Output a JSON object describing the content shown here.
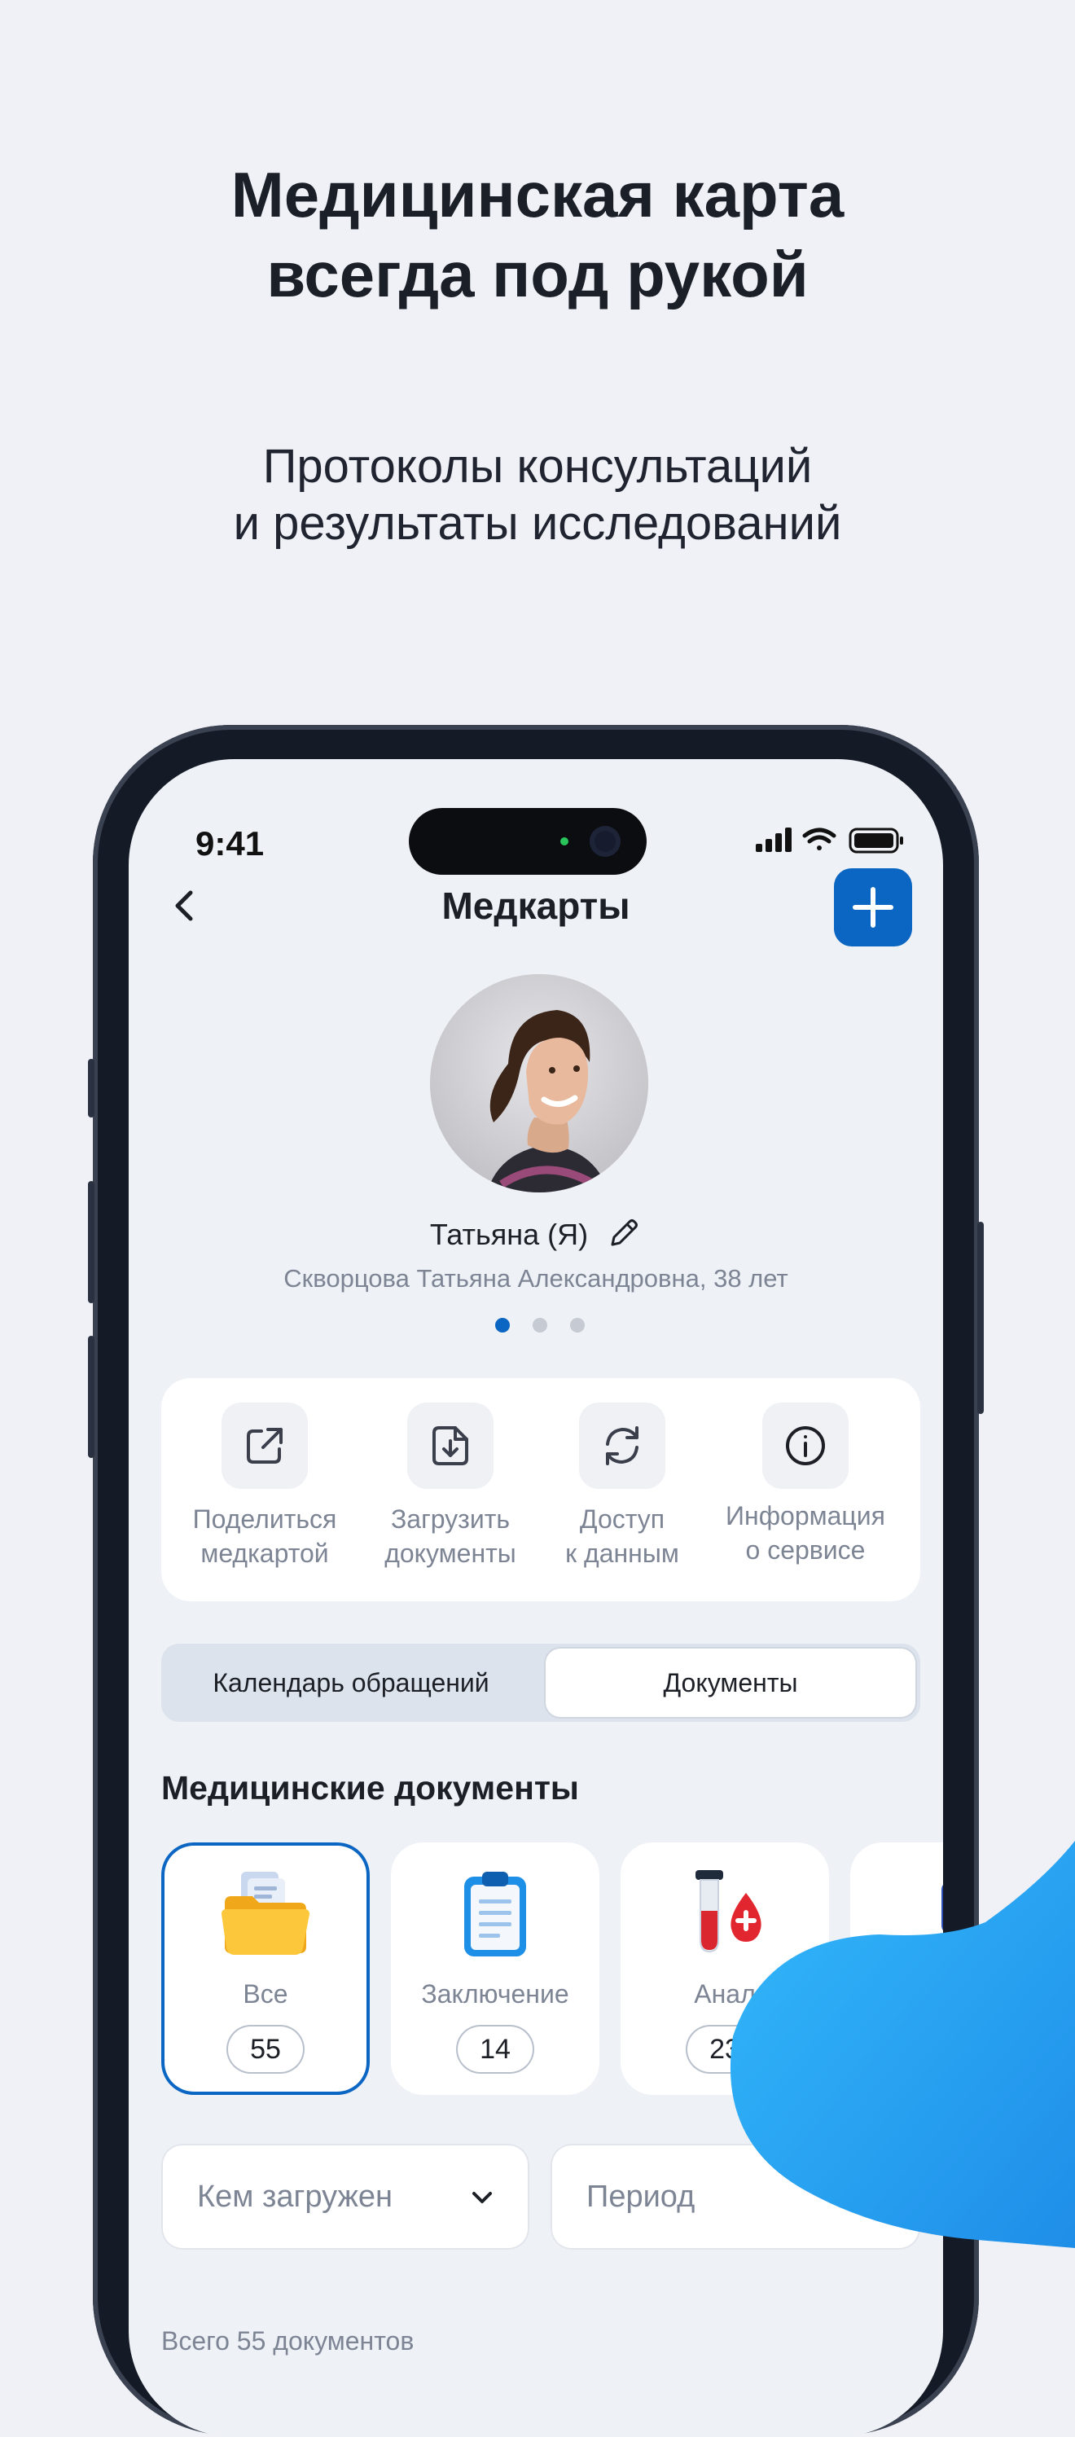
{
  "promo": {
    "headline_line1": "Медицинская карта",
    "headline_line2": "всегда под рукой",
    "subline_line1": "Протоколы консультаций",
    "subline_line2": "и результаты исследований"
  },
  "status_bar": {
    "time": "9:41"
  },
  "nav": {
    "title": "Медкарты"
  },
  "profile": {
    "name": "Татьяна (Я)",
    "details": "Скворцова Татьяна Александровна, 38 лет",
    "page_dots": 3,
    "active_dot": 0
  },
  "actions": [
    {
      "line1": "Поделиться",
      "line2": "медкартой",
      "icon": "share-icon"
    },
    {
      "line1": "Загрузить",
      "line2": "документы",
      "icon": "upload-document-icon"
    },
    {
      "line1": "Доступ",
      "line2": "к данным",
      "icon": "sync-access-icon"
    },
    {
      "line1": "Информация",
      "line2": "о сервисе",
      "icon": "info-icon"
    }
  ],
  "segments": {
    "calendar": "Календарь обращений",
    "documents": "Документы",
    "active": "documents"
  },
  "section": {
    "title": "Медицинские документы"
  },
  "categories": [
    {
      "label": "Все",
      "count": "55",
      "icon": "folder-icon"
    },
    {
      "label": "Заключение",
      "count": "14",
      "icon": "clipboard-icon"
    },
    {
      "label": "Анал",
      "count": "23",
      "icon": "test-tube-icon"
    },
    {
      "label": "",
      "count": "",
      "icon": "scan-icon"
    }
  ],
  "filters": {
    "uploaded_by": "Кем загружен",
    "period": "Период"
  },
  "total": "Всего 55 документов",
  "colors": {
    "accent": "#0a66c2",
    "background": "#eff1f6",
    "muted_text": "#7d8595",
    "blob_light": "#29b6f6",
    "blob_dark": "#1e88e5"
  }
}
